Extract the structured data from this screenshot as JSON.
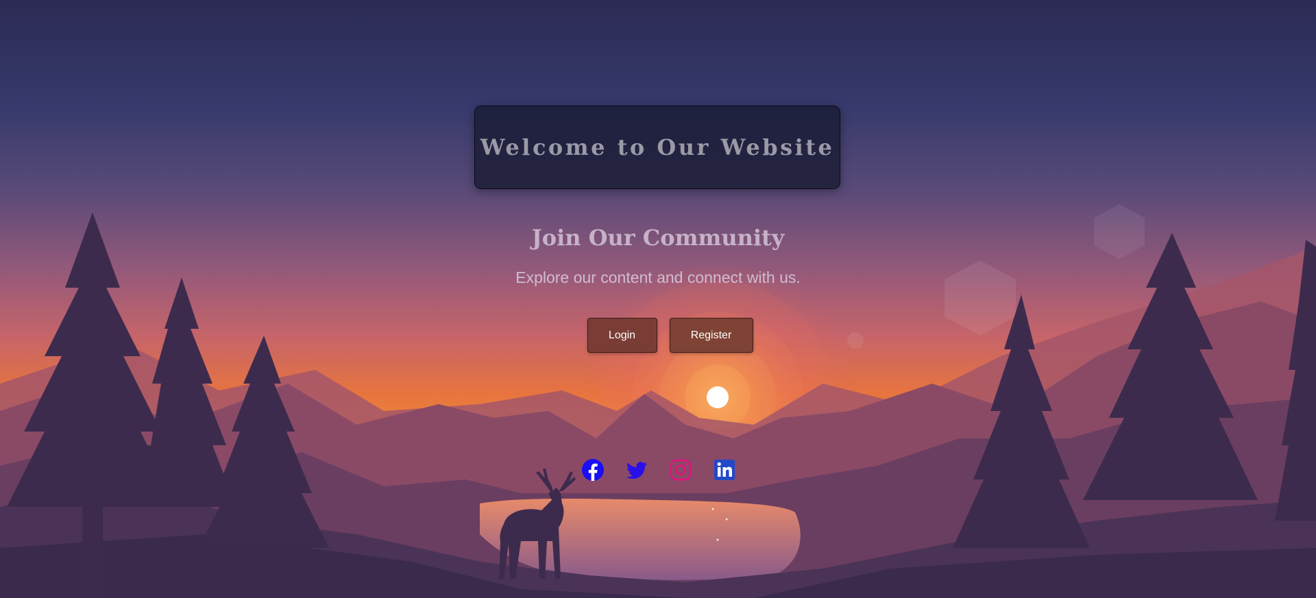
{
  "header": {
    "title": "Welcome to Our Website"
  },
  "hero": {
    "heading": "Join Our Community",
    "tagline": "Explore our content and connect with us."
  },
  "actions": {
    "login_label": "Login",
    "register_label": "Register"
  },
  "social": {
    "items": [
      {
        "icon": "facebook-icon",
        "color": "#1a0ef2"
      },
      {
        "icon": "twitter-icon",
        "color": "#2a10e8"
      },
      {
        "icon": "instagram-icon",
        "color": "#d6187a"
      },
      {
        "icon": "linkedin-icon",
        "color": "#2348c8"
      }
    ]
  },
  "colors": {
    "button_bg": "#7a3d36",
    "title_text": "#9a9aa6",
    "heading_text": "#c7b2c8"
  }
}
